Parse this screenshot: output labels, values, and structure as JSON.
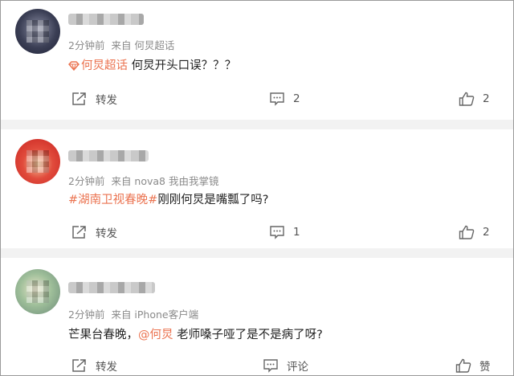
{
  "posts": [
    {
      "meta": {
        "time": "2分钟前",
        "source": "来自 何炅超话"
      },
      "content": {
        "topic": "何炅超话",
        "text": " 何炅开头口误？？？"
      },
      "actions": {
        "repost_label": "转发",
        "comment_label": "2",
        "like_label": "2"
      }
    },
    {
      "meta": {
        "time": "2分钟前",
        "source": "来自 nova8 我由我掌镜"
      },
      "content": {
        "hashtag": "#湖南卫视春晚#",
        "text": "刚刚何炅是嘴瓢了吗?"
      },
      "actions": {
        "repost_label": "转发",
        "comment_label": "1",
        "like_label": "2"
      }
    },
    {
      "meta": {
        "time": "2分钟前",
        "source": "来自 iPhone客户端"
      },
      "content": {
        "prefix": "芒果台春晚，",
        "mention": "@何炅",
        "text": " 老师嗓子哑了是不是病了呀?"
      },
      "actions": {
        "repost_label": "转发",
        "comment_label": "评论",
        "like_label": "赞"
      }
    }
  ],
  "colors": {
    "accent": "#eb7350",
    "meta": "#8a8a8a",
    "separator": "#f2f2f2"
  },
  "icons": [
    "topic-diamond-icon",
    "repost-icon",
    "comment-icon",
    "like-icon"
  ]
}
